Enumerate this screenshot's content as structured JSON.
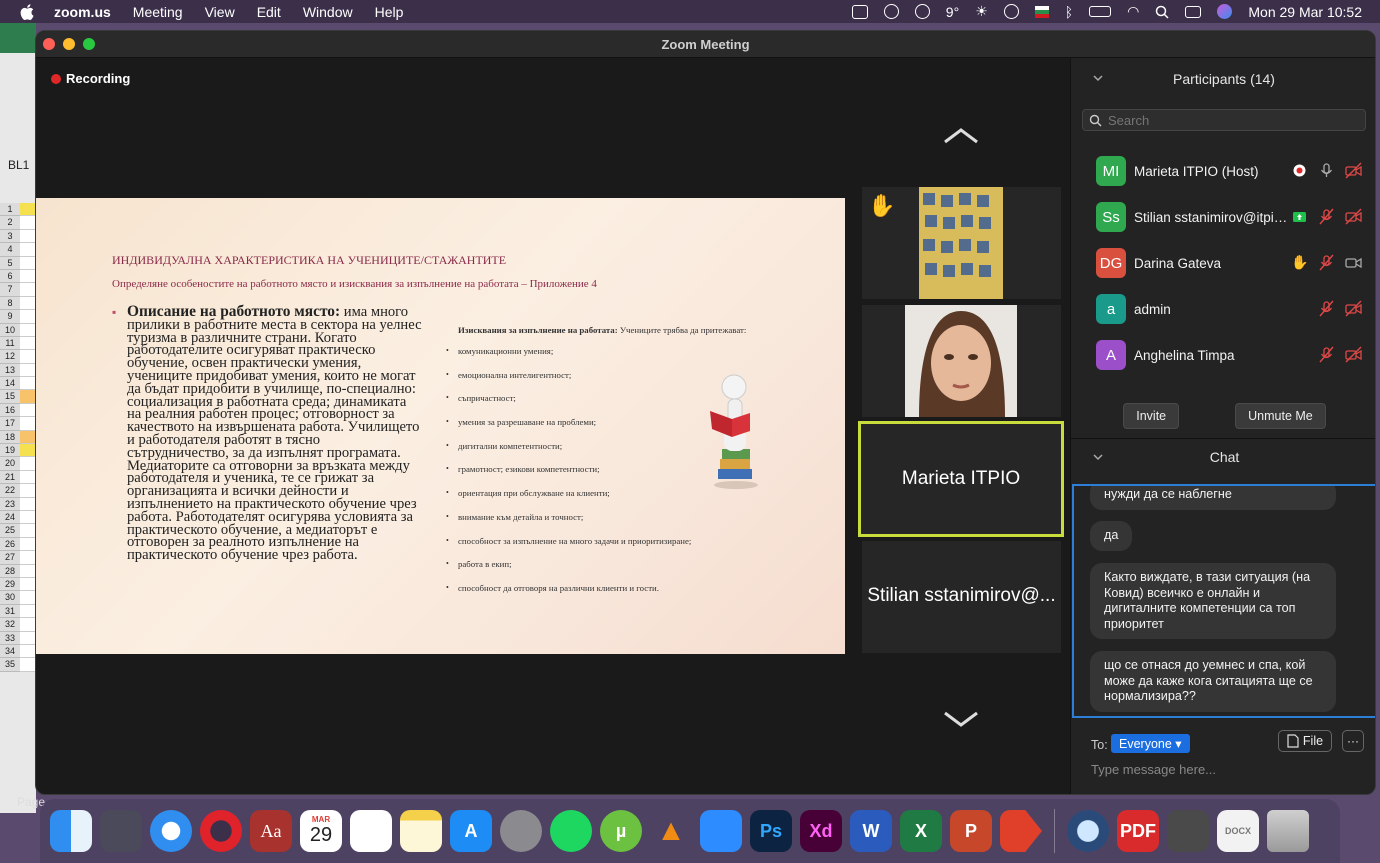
{
  "menubar": {
    "app": "zoom.us",
    "items": [
      "Meeting",
      "View",
      "Edit",
      "Window",
      "Help"
    ],
    "weather": "9°",
    "datetime": "Mon 29 Mar  10:52"
  },
  "window": {
    "title": "Zoom Meeting"
  },
  "recording": {
    "label": "Recording"
  },
  "slide": {
    "title": "ИНДИВИДУАЛНА ХАРАКТЕРИСТИКА НА УЧЕНИЦИТЕ/СТАЖАНТИТЕ",
    "subtitle": "Определяне особеностите на работното място и изисквания за изпълнение на работата – Приложение 4",
    "left_heading": "Описание на работното място:",
    "left_body": " има много прилики в работните места в сектора на уелнес туризма в различните страни. Когато работодателите осигуряват практическо обучение, освен практически умения, учениците придобиват умения, които не могат да бъдат придобити в училище, по-специално: социализация в работната среда; динамиката на реалния работен процес; отговорност за качеството на извършената работа. Училището и работодателя работят в тясно сътрудничество, за да изпълнят програмата. Медиаторите са отговорни за връзката между работодателя и ученика, те се грижат за организацията и всички дейности и изпълнението на практическото обучение чрез работа. Работодателят осигурява условията за практическото обучение, а медиаторът е отговорен за реалното изпълнение на практическото обучение чрез работа.",
    "right_heading": "Изисквания за изпълнение на работата:",
    "right_intro": " Учениците трябва да притежават:",
    "right_items": [
      "комуникационни умения;",
      "емоционална интелигентност;",
      " съпричастност;",
      "умения за разрешаване на проблеми;",
      "дигитални компетентности;",
      "грамотност; езикови компетентности;",
      " ориентация при обслужване на клиенти;",
      "внимание към детайла и точност;",
      "способност за изпълнение на много задачи и приоритизиране;",
      "работа в екип;",
      "способност да отговоря на различни клиенти и гости."
    ]
  },
  "thumbs": {
    "active_name": "Marieta ITPIO",
    "bottom_name": "Stilian sstanimirov@..."
  },
  "participants": {
    "header": "Participants (14)",
    "search_placeholder": "Search",
    "list": [
      {
        "initials": "MI",
        "name": "Marieta ITPIO (Host)",
        "color": "#2fa84f"
      },
      {
        "initials": "Ss",
        "name": "Stilian sstanimirov@itpio...",
        "color": "#2fa84f"
      },
      {
        "initials": "DG",
        "name": "Darina Gateva",
        "color": "#d9503f"
      },
      {
        "initials": "a",
        "name": "admin",
        "color": "#1a9a8a"
      },
      {
        "initials": "A",
        "name": "Anghelina Timpa",
        "color": "#9b4fc9"
      }
    ],
    "invite": "Invite",
    "unmute": "Unmute Me"
  },
  "chat": {
    "header": "Chat",
    "messages": [
      "нужди да се наблегне",
      "да",
      "Както виждате, в тази ситуация (на Ковид) всеичко е онлайн и дигиталните компетенции са топ приоритет",
      "що се отнася до уемнес и спа, кой може да каже кога ситацията ще се нормализира??"
    ],
    "to_label": "To:",
    "to_value": "Everyone ▾",
    "file": "File",
    "more": "···",
    "input_placeholder": "Type message here..."
  },
  "background": {
    "page_label": "Page",
    "sheet_cell": "BL1",
    "row_numbers": [
      "1",
      "2",
      "3",
      "4",
      "5",
      "6",
      "7",
      "8",
      "9",
      "10",
      "11",
      "12",
      "13",
      "14",
      "15",
      "16",
      "17",
      "18",
      "19",
      "20",
      "21",
      "22",
      "23",
      "24",
      "25",
      "26",
      "27",
      "28",
      "29",
      "30",
      "31",
      "32",
      "33",
      "34",
      "35"
    ]
  },
  "dock": {
    "calendar_month": "MAR",
    "calendar_day": "29",
    "dictionary": "Aa",
    "photoshop": "Ps",
    "xd": "Xd",
    "word": "W",
    "excel": "X",
    "powerpoint": "P"
  }
}
